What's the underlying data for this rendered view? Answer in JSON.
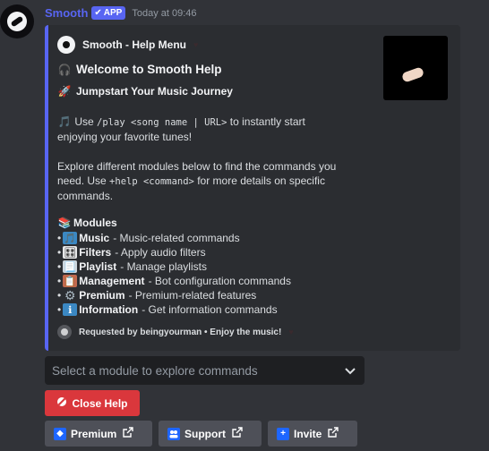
{
  "message": {
    "username": "Smooth",
    "app_badge": "APP",
    "timestamp": "Today at 09:46"
  },
  "embed": {
    "accent_color": "#5865f2",
    "author": "Smooth - Help Menu",
    "title": "Welcome to Smooth Help",
    "subtitle": "Jumpstart Your Music Journey",
    "intro": {
      "prefix": "Use",
      "command": "/play <song name | URL>",
      "suffix": "to instantly start enjoying your favorite tunes!"
    },
    "explore": {
      "prefix": "Explore different modules below to find the commands you need. Use",
      "command": "+help <command>",
      "suffix": "for more details on specific commands."
    },
    "modules_heading": "Modules",
    "modules": [
      {
        "icon": "music-note-icon",
        "glyph": "🎵",
        "name": "Music",
        "desc": "- Music-related commands"
      },
      {
        "icon": "filters-icon",
        "glyph": "🎛",
        "name": "Filters",
        "desc": "- Apply audio filters"
      },
      {
        "icon": "playlist-icon",
        "glyph": "📃",
        "name": "Playlist",
        "desc": "- Manage playlists"
      },
      {
        "icon": "management-icon",
        "glyph": "📋",
        "name": "Management",
        "desc": "- Bot configuration commands"
      },
      {
        "icon": "gear-icon",
        "glyph": "⚙",
        "name": "Premium",
        "desc": "- Premium-related features"
      },
      {
        "icon": "info-icon",
        "glyph": "ℹ",
        "name": "Information",
        "desc": "- Get information commands"
      }
    ],
    "footer": "Requested by beingyourman • Enjoy the music!"
  },
  "select": {
    "placeholder": "Select a module to explore commands"
  },
  "buttons": {
    "close_help": "Close Help",
    "premium": "Premium",
    "support": "Support",
    "invite": "Invite"
  }
}
